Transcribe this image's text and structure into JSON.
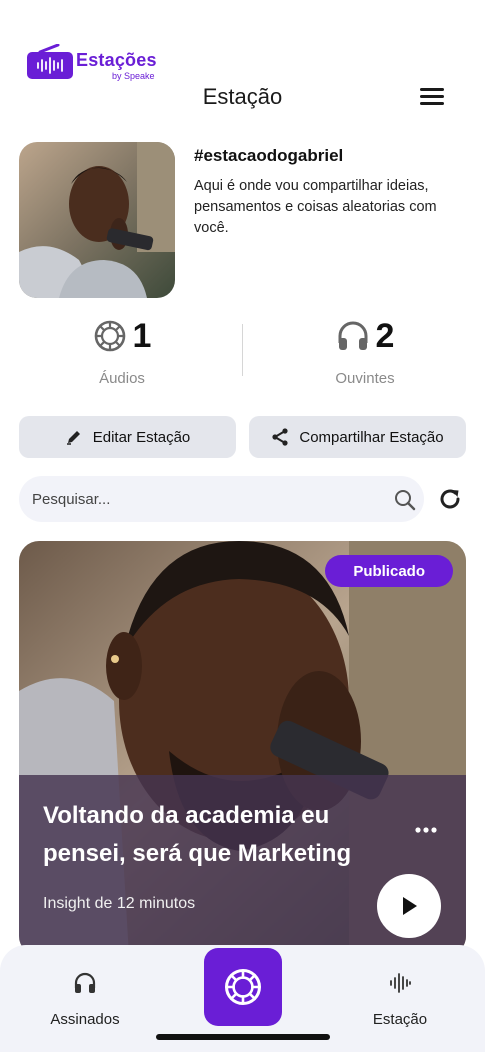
{
  "logo": {
    "brand": "Estações",
    "by": "by Speake"
  },
  "header": {
    "title": "Estação"
  },
  "profile": {
    "name": "#estacaodogabriel",
    "description": "Aqui é onde vou compartilhar ideias, pensamentos e coisas aleatorias com você."
  },
  "stats": {
    "audios": {
      "value": "1",
      "label": "Áudios"
    },
    "listeners": {
      "value": "2",
      "label": "Ouvintes"
    }
  },
  "actions": {
    "edit": "Editar Estação",
    "share": "Compartilhar Estação"
  },
  "search": {
    "placeholder": "Pesquisar..."
  },
  "card": {
    "badge": "Publicado",
    "title": "Voltando da academia eu pensei, será que Marketing",
    "subtitle": "Insight de 12 minutos"
  },
  "nav": {
    "left": "Assinados",
    "right": "Estação"
  },
  "colors": {
    "accent": "#6a1ed6",
    "surface": "#f2f3f9",
    "button": "#e4e6ec"
  },
  "icons": [
    "radio-icon",
    "menu-icon",
    "disc-icon",
    "headphones-icon",
    "pencil-icon",
    "share-icon",
    "search-icon",
    "refresh-icon",
    "more-icon",
    "play-icon",
    "waveform-icon"
  ]
}
